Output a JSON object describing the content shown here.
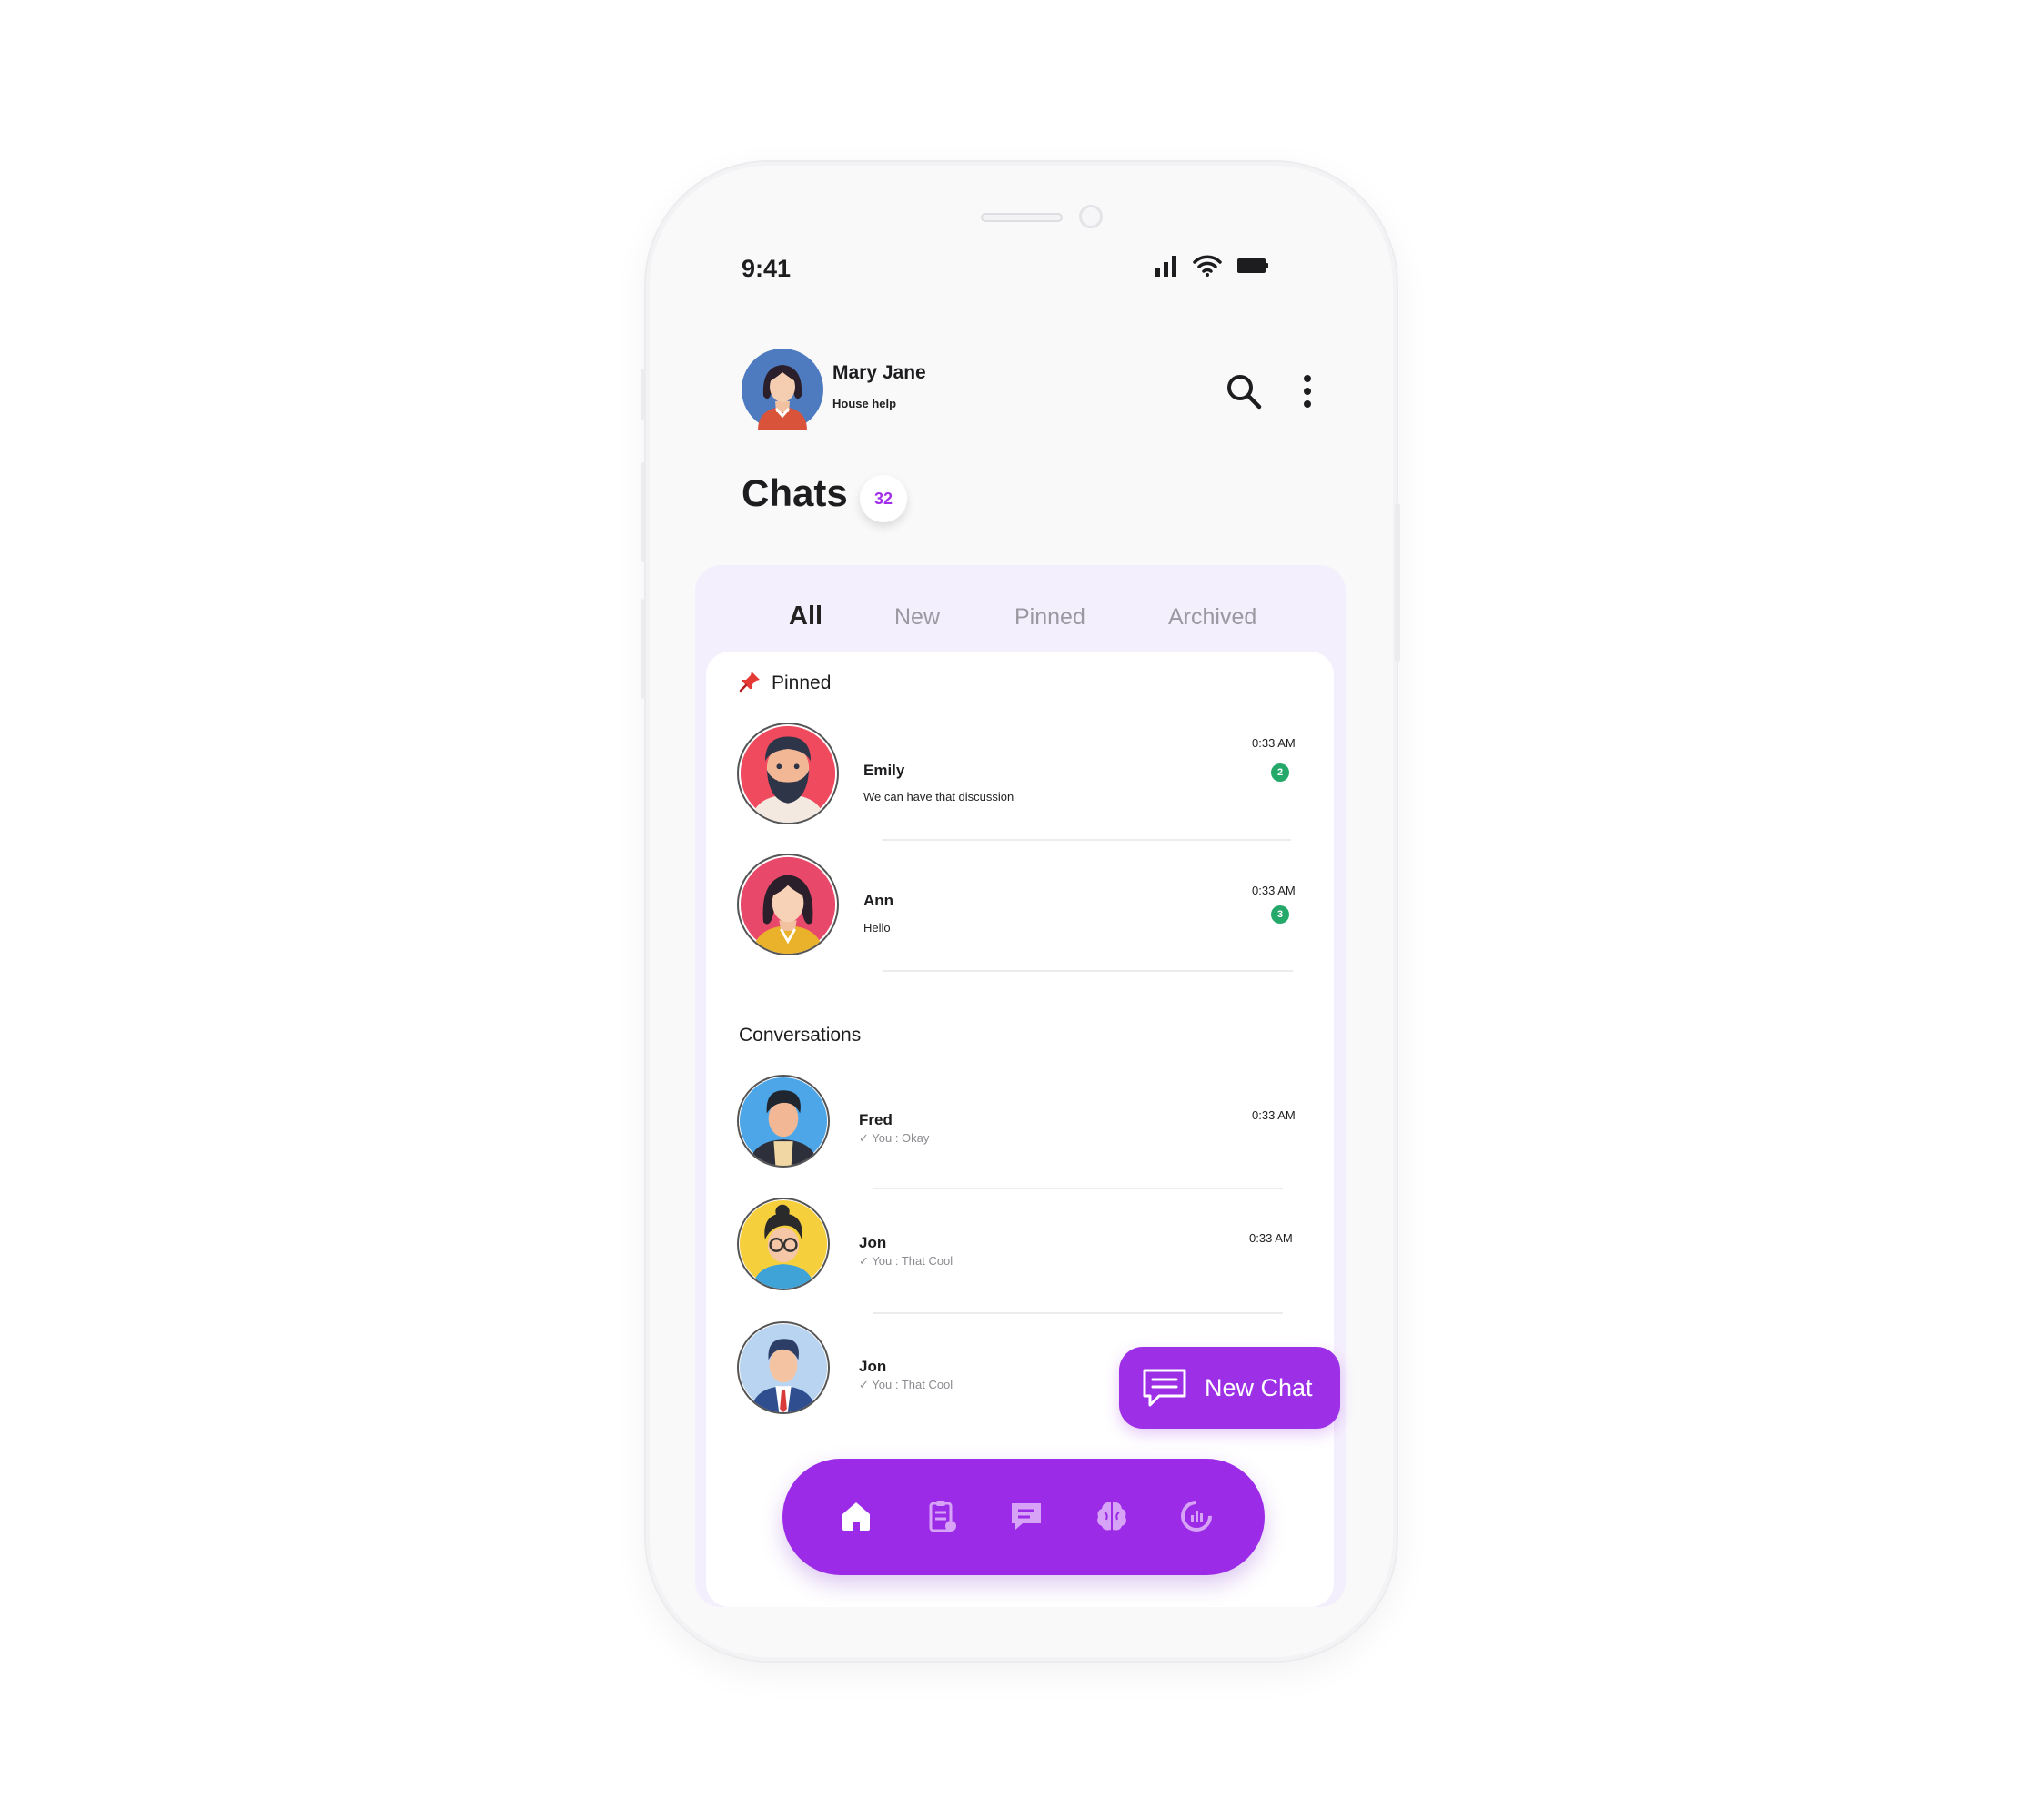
{
  "status_bar": {
    "time": "9:41"
  },
  "profile": {
    "name": "Mary Jane",
    "role": "House help"
  },
  "chats": {
    "title": "Chats",
    "count": "32"
  },
  "tabs": [
    {
      "label": "All",
      "active": true
    },
    {
      "label": "New",
      "active": false
    },
    {
      "label": "Pinned",
      "active": false
    },
    {
      "label": "Archived",
      "active": false
    }
  ],
  "pinned": {
    "title": "Pinned",
    "items": [
      {
        "name": "Emily",
        "message": "We can have that discussion",
        "time": "0:33 AM",
        "unread": "2"
      },
      {
        "name": "Ann",
        "message": "Hello",
        "time": "0:33 AM",
        "unread": "3"
      }
    ]
  },
  "conversations": {
    "title": "Conversations",
    "items": [
      {
        "name": "Fred",
        "message": "You : Okay",
        "time": "0:33 AM"
      },
      {
        "name": "Jon",
        "message": "You : That Cool",
        "time": "0:33 AM"
      },
      {
        "name": "Jon",
        "message": "You : That Cool",
        "time": ""
      }
    ]
  },
  "new_chat": {
    "label": "New Chat"
  },
  "bottom_nav": [
    {
      "icon": "home-icon"
    },
    {
      "icon": "clipboard-icon"
    },
    {
      "icon": "chat-bubble-icon"
    },
    {
      "icon": "brain-icon"
    },
    {
      "icon": "analytics-icon"
    }
  ],
  "colors": {
    "accent": "#9d2fe6",
    "unread": "#25a96b",
    "panel": "#f4effd"
  }
}
